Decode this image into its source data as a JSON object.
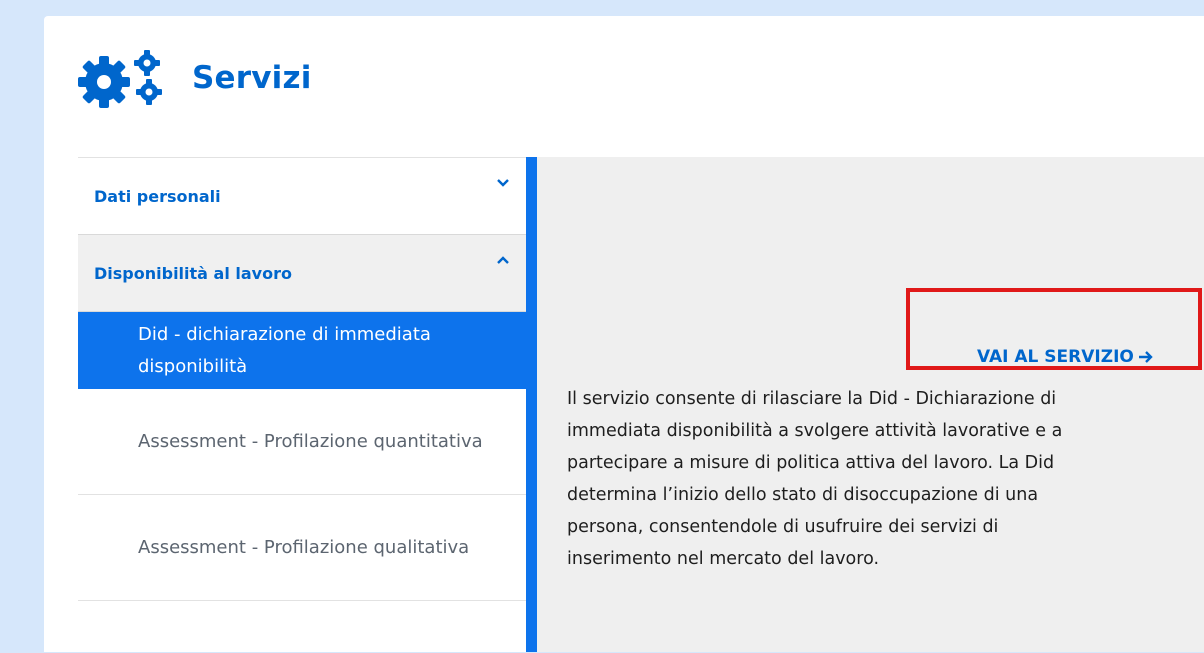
{
  "header": {
    "title": "Servizi",
    "icon": "gears-icon"
  },
  "sidebar": {
    "items": [
      {
        "label": "Dati personali",
        "expanded": false,
        "icon": "chevron-down-icon"
      },
      {
        "label": "Disponibilità al lavoro",
        "expanded": true,
        "icon": "chevron-up-icon",
        "subitems": [
          {
            "label": "Did - dichiarazione di immediata disponibilità",
            "active": true
          },
          {
            "label": "Assessment - Profilazione quantitativa",
            "active": false
          },
          {
            "label": "Assessment - Profilazione qualitativa",
            "active": false
          }
        ]
      }
    ]
  },
  "main": {
    "link_label": "VAI AL SERVIZIO",
    "link_icon": "arrow-right-icon",
    "description": "Il servizio consente di rilasciare la Did - Dichiarazione di immediata disponibilità a svolgere attività lavorative e a partecipare a misure di politica attiva del lavoro. La Did determina l’inizio dello stato di disoccupazione di una persona, consentendole di usufruire dei servizi di inserimento nel mercato del lavoro."
  },
  "colors": {
    "brand_blue": "#0066cc",
    "active_blue": "#0d73ec",
    "page_bg": "#d6e7fb",
    "content_bg": "#efefef",
    "highlight_red": "#e01919"
  }
}
